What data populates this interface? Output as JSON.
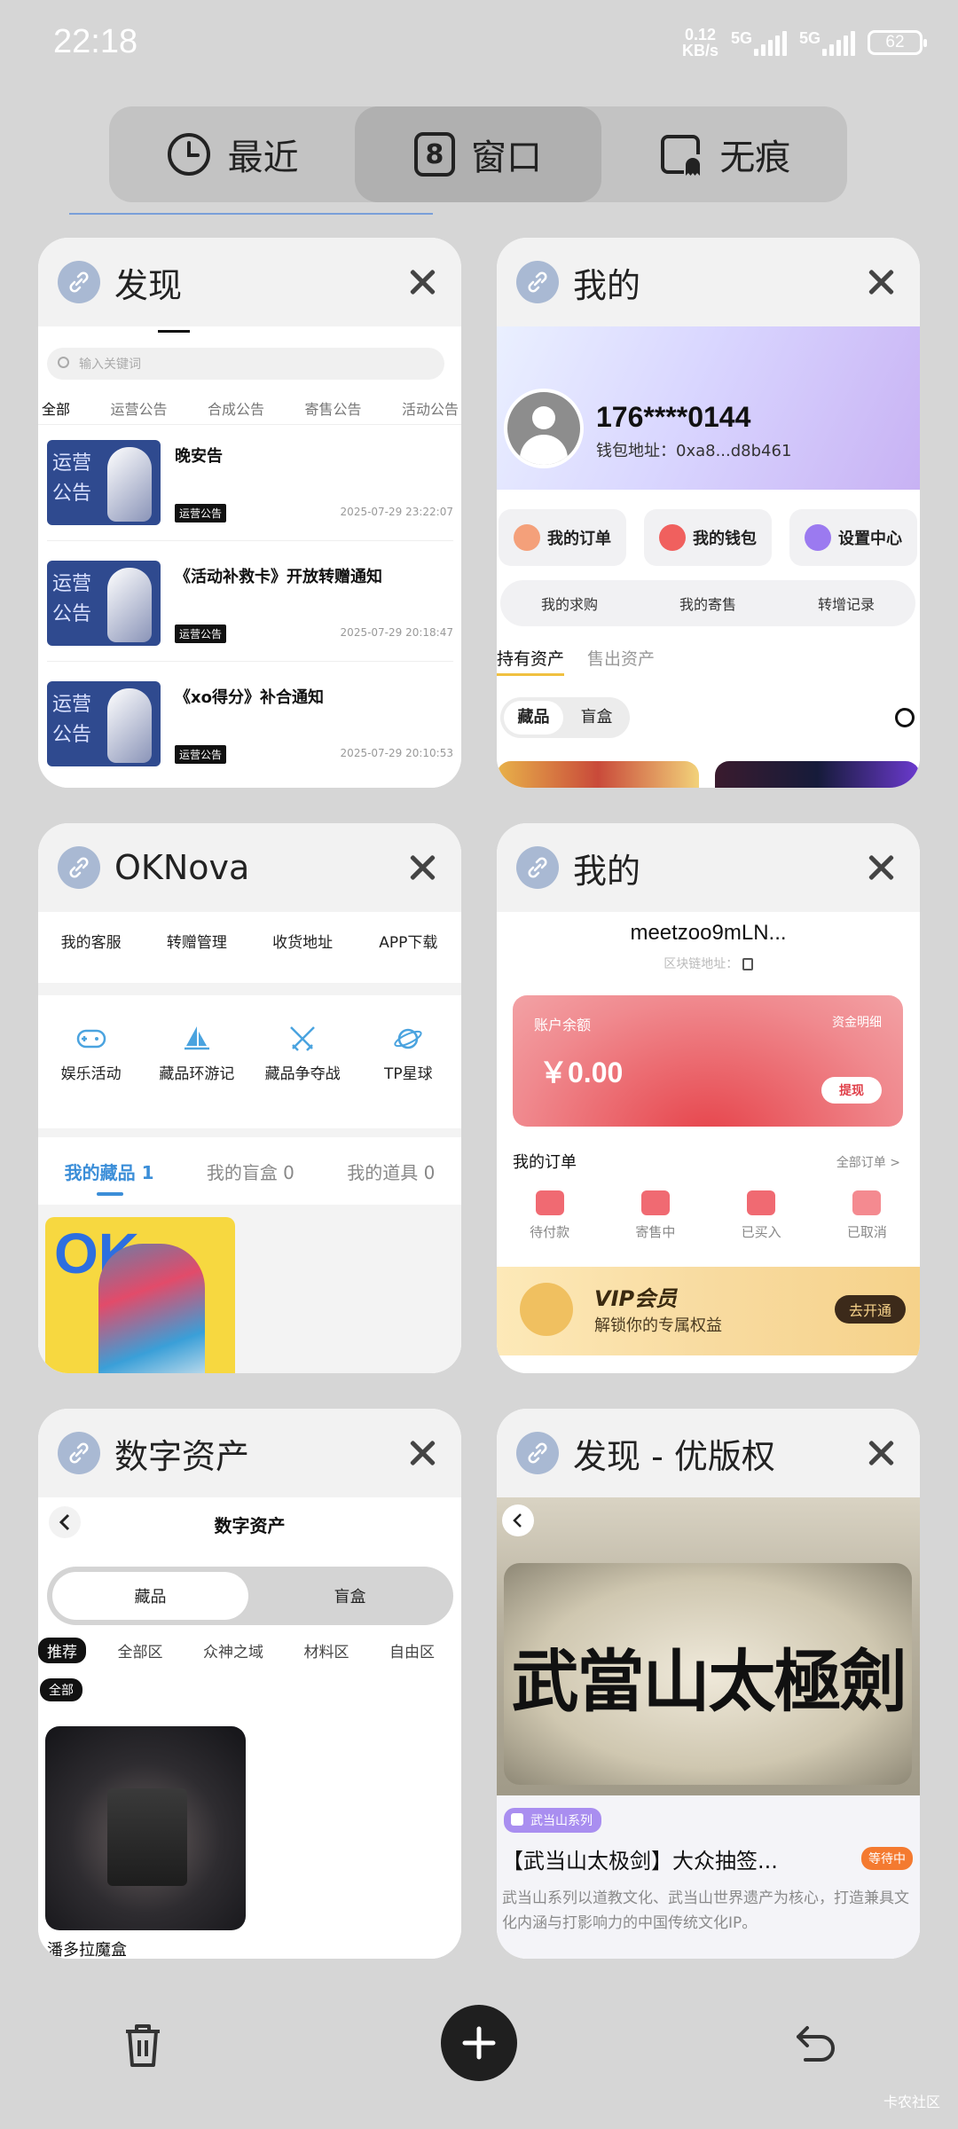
{
  "status_bar": {
    "time": "22:18",
    "network_speed_value": "0.12",
    "network_speed_unit": "KB/s",
    "signal_1": "5G",
    "signal_2": "5G",
    "battery": "62"
  },
  "tabs": [
    {
      "label": "最近",
      "icon": "clock-icon",
      "active": false
    },
    {
      "label": "窗口",
      "icon": "window-count-icon",
      "count": "8",
      "active": true
    },
    {
      "label": "无痕",
      "icon": "incognito-icon",
      "active": false
    }
  ],
  "cards": {
    "faxian": {
      "title": "发现",
      "search_placeholder": "输入关键词",
      "tabs": [
        "全部",
        "运营公告",
        "合成公告",
        "寄售公告",
        "活动公告"
      ],
      "thumb_text_1": "运营",
      "thumb_text_2": "公告",
      "items": [
        {
          "title": "晚安告",
          "badge": "运营公告",
          "date": "2025-07-29 23:22:07"
        },
        {
          "title": "《活动补救卡》开放转赠通知",
          "badge": "运营公告",
          "date": "2025-07-29 20:18:47"
        },
        {
          "title": "《xo得分》补合通知",
          "badge": "运营公告",
          "date": "2025-07-29 20:10:53"
        }
      ]
    },
    "wode1": {
      "title": "我的",
      "phone": "176****0144",
      "wallet_label": "钱包地址：0xa8...d8b461",
      "buttons": [
        "我的订单",
        "我的钱包",
        "设置中心"
      ],
      "row2": [
        "我的求购",
        "我的寄售",
        "转增记录"
      ],
      "asset_tabs": [
        "持有资产",
        "售出资产"
      ],
      "seg": [
        "藏品",
        "盲盒"
      ]
    },
    "oknova": {
      "title": "OKNova",
      "row1": [
        "我的客服",
        "转赠管理",
        "收货地址",
        "APP下载"
      ],
      "row2": [
        "娱乐活动",
        "藏品环游记",
        "藏品争夺战",
        "TP星球"
      ],
      "tabs": [
        "我的藏品 1",
        "我的盲盒 0",
        "我的道具 0"
      ],
      "art_text": "OK"
    },
    "wode2": {
      "title": "我的",
      "username": "meetzoo9mLN...",
      "chain_addr": "区块链地址：",
      "balance_label": "账户余额",
      "balance_detail": "资金明细",
      "balance": "￥0.00",
      "withdraw": "提现",
      "orders_label": "我的订单",
      "orders_all": "全部订单 >",
      "order_states": [
        "待付款",
        "寄售中",
        "已买入",
        "已取消"
      ],
      "vip_title": "VIP会员",
      "vip_desc": "解锁你的专属权益",
      "vip_btn": "去开通"
    },
    "shuzi": {
      "title": "数字资产",
      "page_title": "数字资产",
      "seg": [
        "藏品",
        "盲盒"
      ],
      "cats": [
        "推荐",
        "全部区",
        "众神之域",
        "材料区",
        "自由区"
      ],
      "all_tag": "全部",
      "item_name": "潘多拉魔盒"
    },
    "youbanquan": {
      "title": "发现 - 优版权",
      "calligraphy": "武當山太極劍",
      "series_tag": "武当山系列",
      "item_title": "【武当山太极剑】大众抽签...",
      "status": "等待中",
      "desc": "武当山系列以道教文化、武当山世界遗产为核心，打造兼具文化内涵与打影响力的中国传统文化IP。"
    }
  },
  "bottom": {
    "watermark": "卡农社区"
  }
}
